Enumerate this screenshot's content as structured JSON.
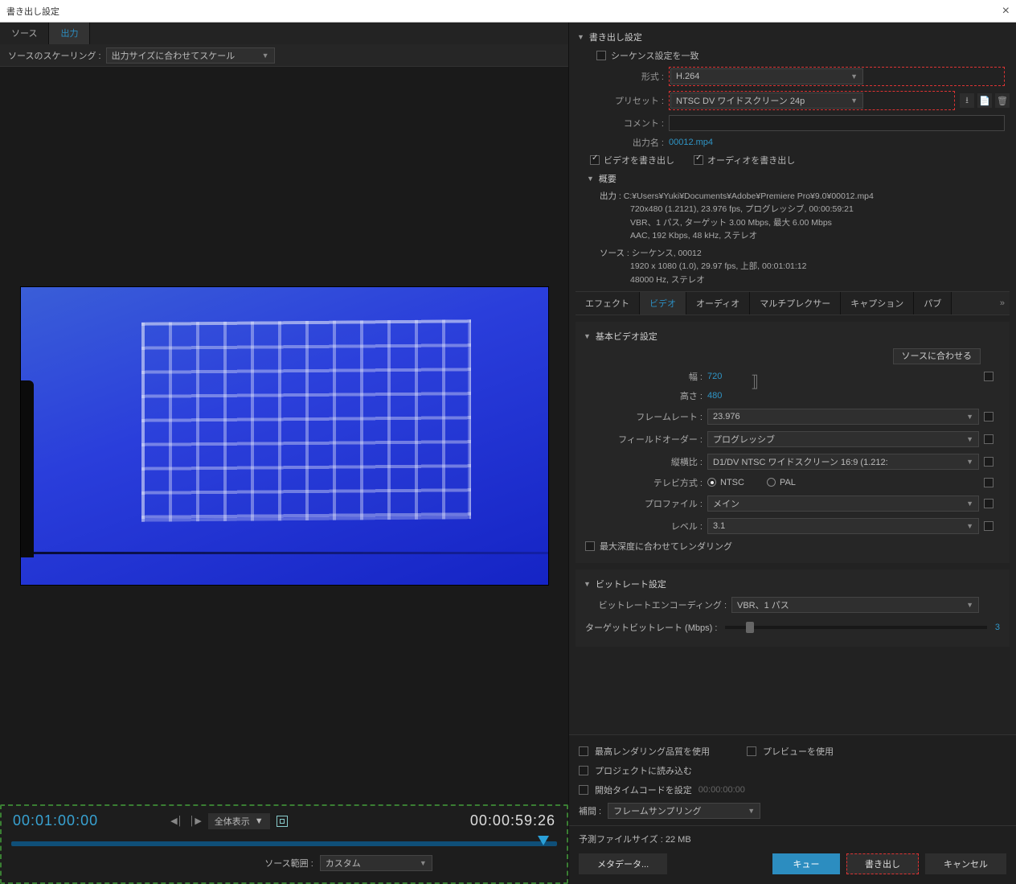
{
  "window": {
    "title": "書き出し設定"
  },
  "tabs": {
    "source": "ソース",
    "output": "出力"
  },
  "scaling": {
    "label": "ソースのスケーリング :",
    "value": "出力サイズに合わせてスケール"
  },
  "timeline": {
    "time_left": "00:01:00:00",
    "time_right": "00:00:59:26",
    "fit": "全体表示",
    "range_label": "ソース範囲 :",
    "range_value": "カスタム"
  },
  "export": {
    "header": "書き出し設定",
    "match_seq": "シーケンス設定を一致",
    "format_label": "形式 :",
    "format_value": "H.264",
    "preset_label": "プリセット :",
    "preset_value": "NTSC DV ワイドスクリーン  24p",
    "comment_label": "コメント :",
    "outname_label": "出力名 :",
    "outname_value": "00012.mp4",
    "cb_video": "ビデオを書き出し",
    "cb_audio": "オーディオを書き出し"
  },
  "summary": {
    "header": "概要",
    "out_label": "出力 :",
    "out_l1": "C:¥Users¥Yuki¥Documents¥Adobe¥Premiere Pro¥9.0¥00012.mp4",
    "out_l2": "720x480 (1.2121), 23.976 fps, プログレッシブ, 00:00:59:21",
    "out_l3": "VBR、1 パス, ターゲット 3.00 Mbps, 最大 6.00 Mbps",
    "out_l4": "AAC, 192 Kbps, 48 kHz, ステレオ",
    "src_label": "ソース :",
    "src_l1": "シーケンス, 00012",
    "src_l2": "1920 x 1080 (1.0), 29.97 fps, 上部, 00:01:01:12",
    "src_l3": "48000 Hz, ステレオ"
  },
  "tabs2": {
    "effects": "エフェクト",
    "video": "ビデオ",
    "audio": "オーディオ",
    "mux": "マルチプレクサー",
    "caption": "キャプション",
    "pub": "パブ"
  },
  "video": {
    "group_basic": "基本ビデオ設定",
    "match_source_btn": "ソースに合わせる",
    "width_label": "幅 :",
    "width_value": "720",
    "height_label": "高さ :",
    "height_value": "480",
    "fps_label": "フレームレート :",
    "fps_value": "23.976",
    "field_label": "フィールドオーダー :",
    "field_value": "プログレッシブ",
    "aspect_label": "縦横比 :",
    "aspect_value": "D1/DV NTSC ワイドスクリーン 16:9 (1.212:",
    "tv_label": "テレビ方式 :",
    "ntsc": "NTSC",
    "pal": "PAL",
    "profile_label": "プロファイル :",
    "profile_value": "メイン",
    "level_label": "レベル :",
    "level_value": "3.1",
    "max_depth": "最大深度に合わせてレンダリング"
  },
  "bitrate": {
    "group": "ビットレート設定",
    "encoding_label": "ビットレートエンコーディング :",
    "encoding_value": "VBR、1 パス",
    "target_label": "ターゲットビットレート (Mbps) :",
    "target_value": "3"
  },
  "bottom": {
    "max_quality": "最高レンダリング品質を使用",
    "use_preview": "プレビューを使用",
    "import_project": "プロジェクトに読み込む",
    "start_tc": "開始タイムコードを設定",
    "start_tc_val": "00:00:00:00",
    "interp_label": "補間 :",
    "interp_value": "フレームサンプリング",
    "filesize_label": "予測ファイルサイズ :",
    "filesize_value": "22 MB"
  },
  "footer": {
    "metadata": "メタデータ...",
    "queue": "キュー",
    "export": "書き出し",
    "cancel": "キャンセル"
  }
}
